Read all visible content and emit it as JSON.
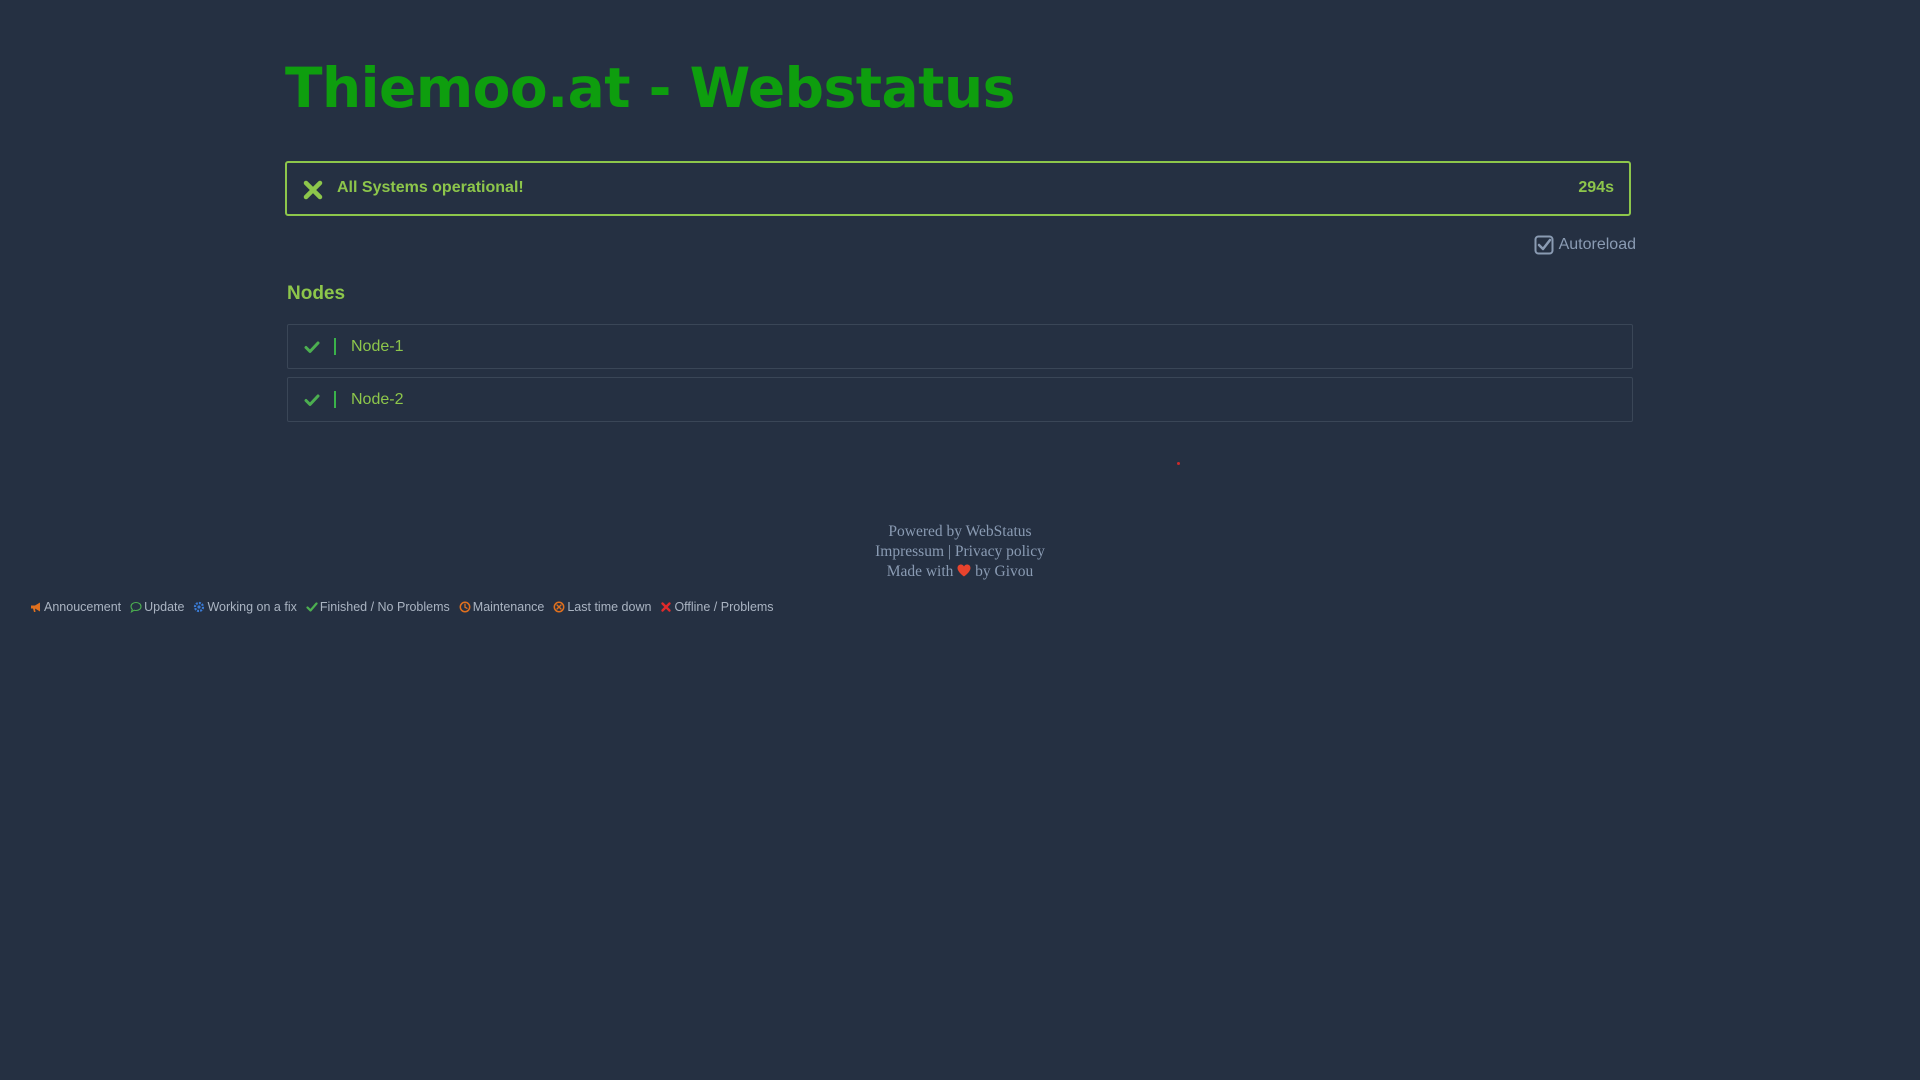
{
  "header": {
    "title": "Thiemoo.at - Webstatus"
  },
  "status": {
    "icon": "times-icon",
    "message": "All Systems operational!",
    "timer": "294s",
    "color": "#8dc64b"
  },
  "autoreload": {
    "label": "Autoreload",
    "checked": true
  },
  "nodes": {
    "title": "Nodes",
    "items": [
      {
        "label": "Node-1",
        "status": "ok",
        "icon": "check-icon"
      },
      {
        "label": "Node-2",
        "status": "ok",
        "icon": "check-icon"
      }
    ]
  },
  "footer": {
    "powered_prefix": "Powered by",
    "powered_link": "WebStatus",
    "impressum": "Impressum",
    "separator": "|",
    "privacy": "Privacy policy",
    "made_with": "Made with",
    "by": "by",
    "author": "Givou"
  },
  "legend": [
    {
      "icon": "bullhorn-icon",
      "label": "Annoucement",
      "color": "#e0701e"
    },
    {
      "icon": "comment-icon",
      "label": "Update",
      "color": "#4caf50"
    },
    {
      "icon": "cog-icon",
      "label": "Working on a fix",
      "color": "#3a7bd5"
    },
    {
      "icon": "check-icon",
      "label": "Finished / No Problems",
      "color": "#4caf50"
    },
    {
      "icon": "clock-icon",
      "label": "Maintenance",
      "color": "#e0701e"
    },
    {
      "icon": "times-circle-icon",
      "label": "Last time down",
      "color": "#e0701e"
    },
    {
      "icon": "times-icon",
      "label": "Offline / Problems",
      "color": "#e02a2a"
    }
  ]
}
